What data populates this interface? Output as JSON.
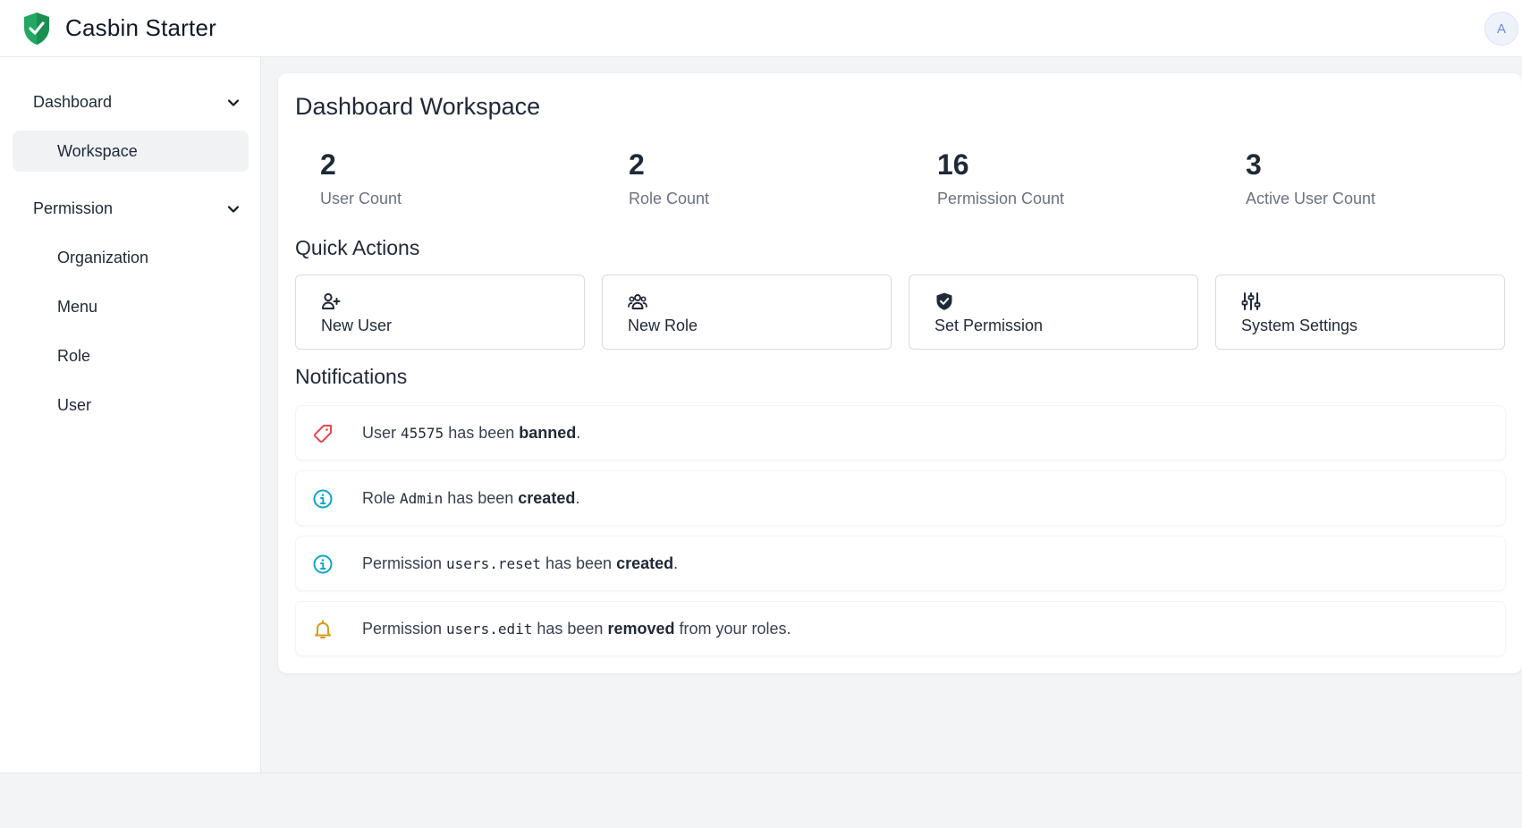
{
  "app": {
    "title": "Casbin Starter",
    "avatar_initial": "A"
  },
  "sidebar": {
    "groups": [
      {
        "label": "Dashboard",
        "items": [
          {
            "label": "Workspace",
            "active": true
          }
        ]
      },
      {
        "label": "Permission",
        "items": [
          {
            "label": "Organization"
          },
          {
            "label": "Menu"
          },
          {
            "label": "Role"
          },
          {
            "label": "User"
          }
        ]
      }
    ]
  },
  "main": {
    "title": "Dashboard Workspace",
    "stats": [
      {
        "value": "2",
        "label": "User Count"
      },
      {
        "value": "2",
        "label": "Role Count"
      },
      {
        "value": "16",
        "label": "Permission Count"
      },
      {
        "value": "3",
        "label": "Active User Count"
      }
    ],
    "quick_actions_title": "Quick Actions",
    "quick_actions": [
      {
        "label": "New User",
        "icon": "user-plus-icon"
      },
      {
        "label": "New Role",
        "icon": "users-icon"
      },
      {
        "label": "Set Permission",
        "icon": "shield-check-icon"
      },
      {
        "label": "System Settings",
        "icon": "sliders-icon"
      }
    ],
    "notifications_title": "Notifications",
    "notifications": [
      {
        "icon": "tag-icon",
        "icon_color": "#e5484d",
        "prefix": "User ",
        "code": "45575",
        "middle": " has been ",
        "action": "banned",
        "suffix": "."
      },
      {
        "icon": "info-icon",
        "icon_color": "#0ea5c6",
        "prefix": "Role ",
        "code": "Admin",
        "middle": " has been ",
        "action": "created",
        "suffix": "."
      },
      {
        "icon": "info-icon",
        "icon_color": "#0ea5c6",
        "prefix": "Permission ",
        "code": "users.reset",
        "middle": " has been ",
        "action": "created",
        "suffix": "."
      },
      {
        "icon": "bell-icon",
        "icon_color": "#d99a1e",
        "prefix": "Permission ",
        "code": "users.edit",
        "middle": " has been ",
        "action": "removed",
        "suffix": " from your roles."
      }
    ]
  },
  "colors": {
    "brand": "#22a862",
    "accent": "#6b8bd6"
  }
}
